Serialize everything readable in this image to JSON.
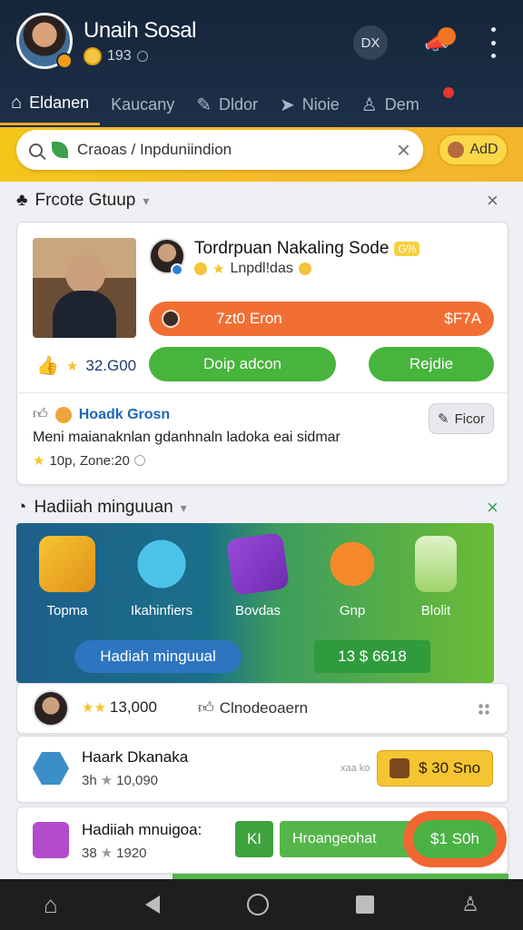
{
  "header": {
    "title": "Unaih Sosal",
    "coins": "193",
    "icon_button_label": "DX",
    "megaphone_icon": "megaphone-icon",
    "menu_icon": "vertical-dots-icon"
  },
  "tabs": [
    {
      "label": "Eldanen",
      "icon": "home-icon",
      "active": true
    },
    {
      "label": "Kaucany",
      "icon": "",
      "active": false
    },
    {
      "label": "Dldor",
      "icon": "pencil-icon",
      "active": false
    },
    {
      "label": "Nioie",
      "icon": "tag-icon",
      "active": false
    },
    {
      "label": "Dem",
      "icon": "user-icon",
      "active": false
    }
  ],
  "search": {
    "text": "Craoas / Inpduniindion",
    "add_label": "AdD"
  },
  "section1": {
    "title": "Frcote Gtuup"
  },
  "post": {
    "title": "Tordrpuan Nakaling Sode",
    "badge": "G%",
    "sub": "Lnpdl!das",
    "bar_left": "7zt0 Eron",
    "bar_right": "$F7A",
    "likes": "32.G00",
    "btn_primary": "Doip adcon",
    "btn_secondary": "Rejdie",
    "tip_name": "Hoadk Grosn",
    "tip_text": "Meni maianaknlan gdanhnaln ladoka eai sidmar",
    "tip_meta": "10p, Zone:20",
    "edit_label": "Ficor"
  },
  "section2": {
    "title": "Hadiiah minguuan"
  },
  "rewards": [
    {
      "label": "Topma"
    },
    {
      "label": "Ikahinfiers"
    },
    {
      "label": "Bovdas"
    },
    {
      "label": "Gnp"
    },
    {
      "label": "Blolit"
    }
  ],
  "banner": {
    "pill_left": "Hadiah minguual",
    "pill_right": "13 $ 6618"
  },
  "row1": {
    "amount": "13,000",
    "sub": "Clnodeoaern"
  },
  "row2": {
    "title": "Haark Dkanaka",
    "meta": "3h",
    "score": "10,090",
    "small": "xaa ko",
    "price": "$ 30 Sno"
  },
  "row3": {
    "title": "Hadiiah mnuigoa:",
    "meta": "38",
    "score": "1920",
    "ki": "KI",
    "long": "Hroangeohat",
    "price": "$1 S0h"
  }
}
